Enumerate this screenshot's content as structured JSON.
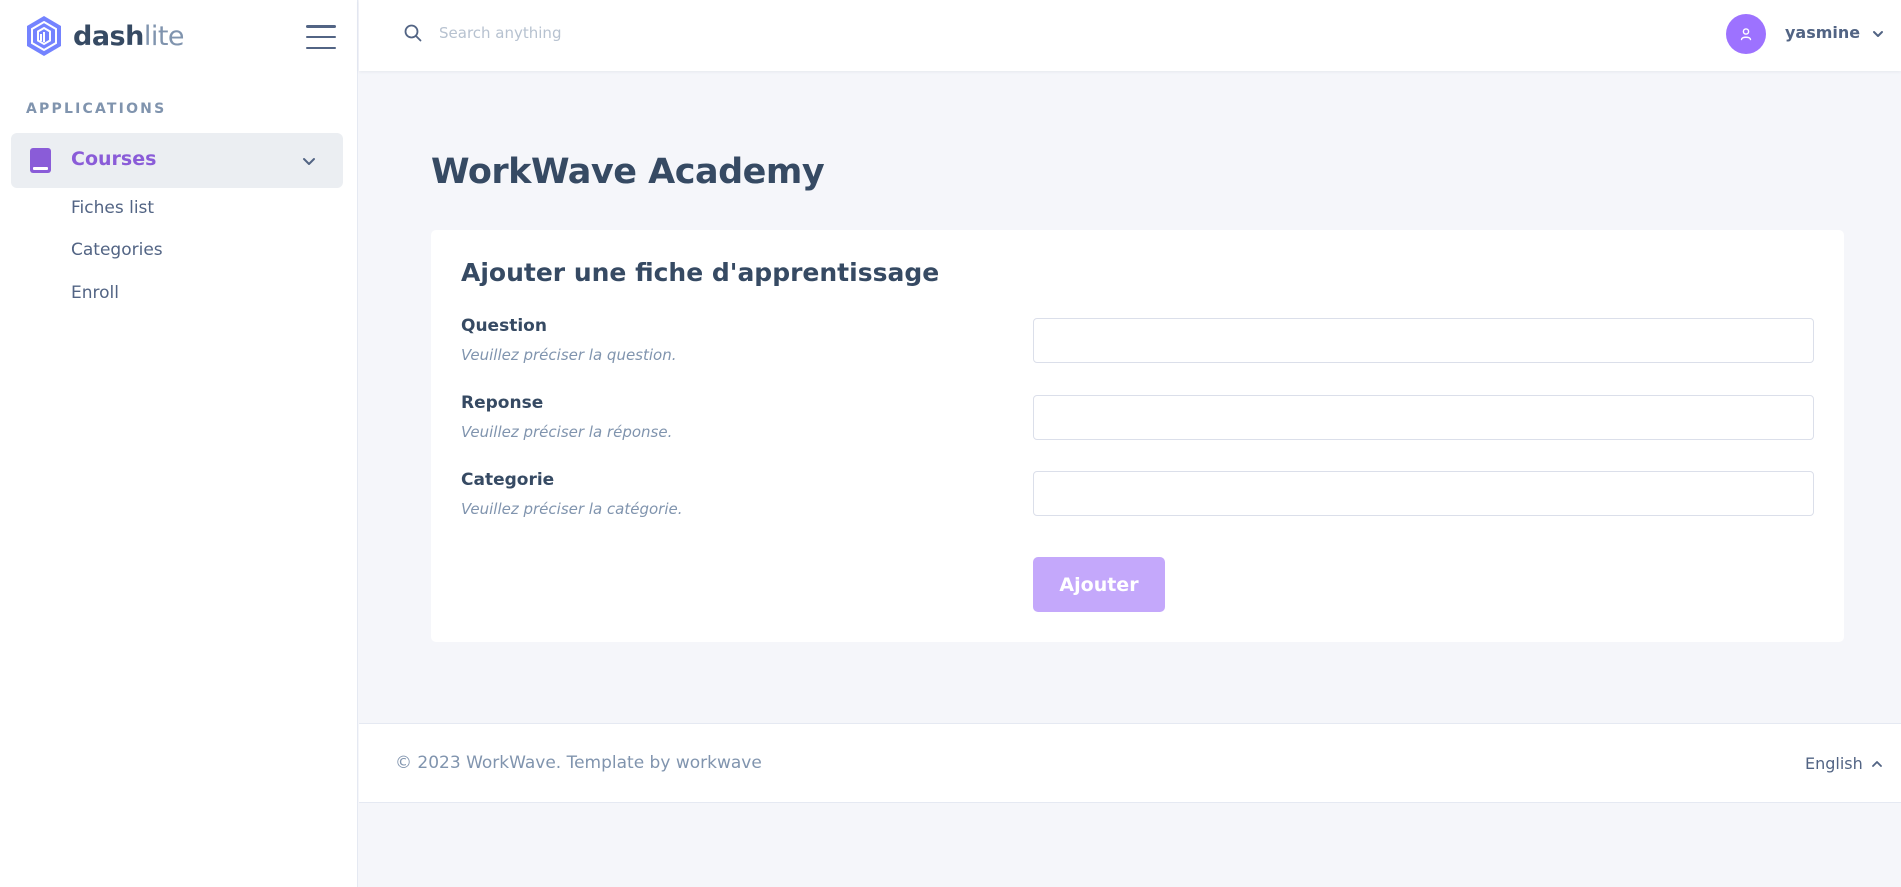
{
  "brand": {
    "name_bold": "dash",
    "name_light": "lite"
  },
  "sidebar": {
    "heading": "APPLICATIONS",
    "active_item": {
      "label": "Courses",
      "icon": "book-icon"
    },
    "sub_items": [
      {
        "label": "Fiches list"
      },
      {
        "label": "Categories"
      },
      {
        "label": "Enroll"
      }
    ]
  },
  "header": {
    "search": {
      "placeholder": "Search anything",
      "value": ""
    },
    "user": {
      "name": "yasmine",
      "icon": "user-icon"
    }
  },
  "main": {
    "page_title": "WorkWave Academy",
    "form": {
      "title": "Ajouter une fiche d'apprentissage",
      "fields": [
        {
          "label": "Question",
          "hint": "Veuillez préciser la question.",
          "value": ""
        },
        {
          "label": "Reponse",
          "hint": "Veuillez préciser la réponse.",
          "value": ""
        },
        {
          "label": "Categorie",
          "hint": "Veuillez préciser la catégorie.",
          "value": ""
        }
      ],
      "submit_label": "Ajouter"
    }
  },
  "footer": {
    "copyright": "© 2023 WorkWave. Template by workwave",
    "language": "English"
  },
  "colors": {
    "accent": "#9d72ff",
    "accent_text": "#8a5cd8",
    "button_disabled": "#c4a8fb",
    "text_dark": "#364a63",
    "text_muted": "#8094ae",
    "background": "#f5f6fa"
  }
}
